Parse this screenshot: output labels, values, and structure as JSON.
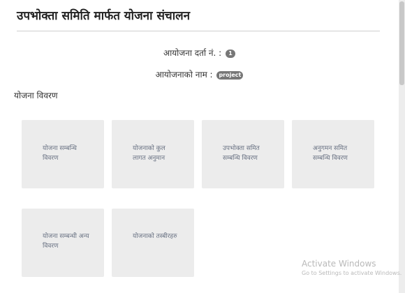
{
  "header": {
    "title": "उपभोक्ता समिति मार्फत योजना संचालन"
  },
  "info": {
    "registration_label": "आयोजना दर्ता नं. :",
    "registration_badge": "1",
    "name_label": "आयोजनाको नाम :",
    "name_badge": "project"
  },
  "section": {
    "heading": "योजना विवरण"
  },
  "tiles": [
    {
      "label": "योजना सम्बन्धि विवरण"
    },
    {
      "label": "योजनाको कुल लागत अनुमान"
    },
    {
      "label": "उपभोक्ता समित सम्बन्धि विवरण"
    },
    {
      "label": "अनुगमन समित सम्बन्धि विवरण"
    },
    {
      "label": "योजना सम्बन्धी अन्य विवरण"
    },
    {
      "label": "योजनाको तस्बीरहरु"
    }
  ],
  "watermark": {
    "title": "Activate Windows",
    "subtitle": "Go to Settings to activate Windows."
  },
  "colors": {
    "tile_background": "#ececec",
    "tile_text": "#666f80",
    "badge_background": "#777777"
  }
}
